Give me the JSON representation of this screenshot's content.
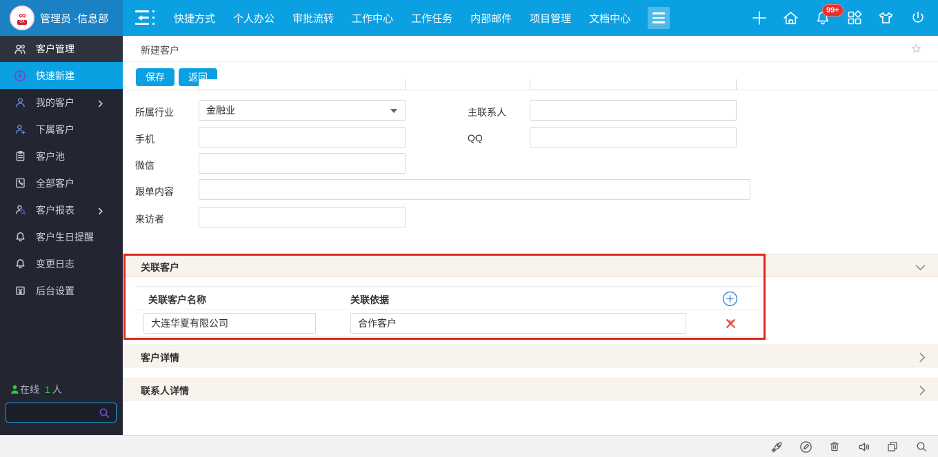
{
  "topbar": {
    "user_label": "管理员 -信息部",
    "nav_items": [
      "快捷方式",
      "个人办公",
      "审批流转",
      "工作中心",
      "工作任务",
      "内部邮件",
      "项目管理",
      "文档中心"
    ],
    "notification_badge": "99+"
  },
  "sidebar": {
    "items": [
      {
        "label": "客户管理"
      },
      {
        "label": "快速新建",
        "active": true
      },
      {
        "label": "我的客户",
        "expandable": true
      },
      {
        "label": "下属客户"
      },
      {
        "label": "客户池"
      },
      {
        "label": "全部客户"
      },
      {
        "label": "客户报表",
        "expandable": true
      },
      {
        "label": "客户生日提醒"
      },
      {
        "label": "变更日志"
      },
      {
        "label": "后台设置"
      }
    ],
    "online_prefix": "在线",
    "online_count": "1",
    "online_suffix": "人",
    "search_value": ""
  },
  "page": {
    "breadcrumb": "新建客户"
  },
  "toolbar": {
    "save_label": "保存",
    "back_label": "返回"
  },
  "form": {
    "fields": {
      "industry": {
        "label": "所属行业",
        "value": "金融业"
      },
      "primary_contact": {
        "label": "主联系人",
        "value": ""
      },
      "mobile": {
        "label": "手机",
        "value": ""
      },
      "qq": {
        "label": "QQ",
        "value": ""
      },
      "wechat": {
        "label": "微信",
        "value": ""
      },
      "follow_content": {
        "label": "跟单内容",
        "value": ""
      },
      "visitor": {
        "label": "来访者",
        "value": ""
      }
    }
  },
  "related_customers": {
    "section_title": "关联客户",
    "columns": {
      "name": "关联客户名称",
      "basis": "关联依据"
    },
    "rows": [
      {
        "name": "大连华夏有限公司",
        "basis": "合作客户"
      }
    ]
  },
  "collapsed_sections": [
    {
      "title": "客户详情"
    },
    {
      "title": "联系人详情"
    }
  ],
  "colors": {
    "topbar_blue": "#0ba0e2",
    "brand_bg": "#1a81c5",
    "sidebar_bg": "#232631",
    "sidebar_header_bg": "#2f3340",
    "active_item_blue": "#0ba0e2",
    "annotation_red": "#e1251b",
    "section_header_bg": "#f8f3ec",
    "badge_red": "#ea2e2e",
    "online_green": "#2ecc40",
    "button_blue": "#0ba0e2",
    "delete_red": "#e74c3c",
    "add_blue": "#3b7fd4"
  }
}
